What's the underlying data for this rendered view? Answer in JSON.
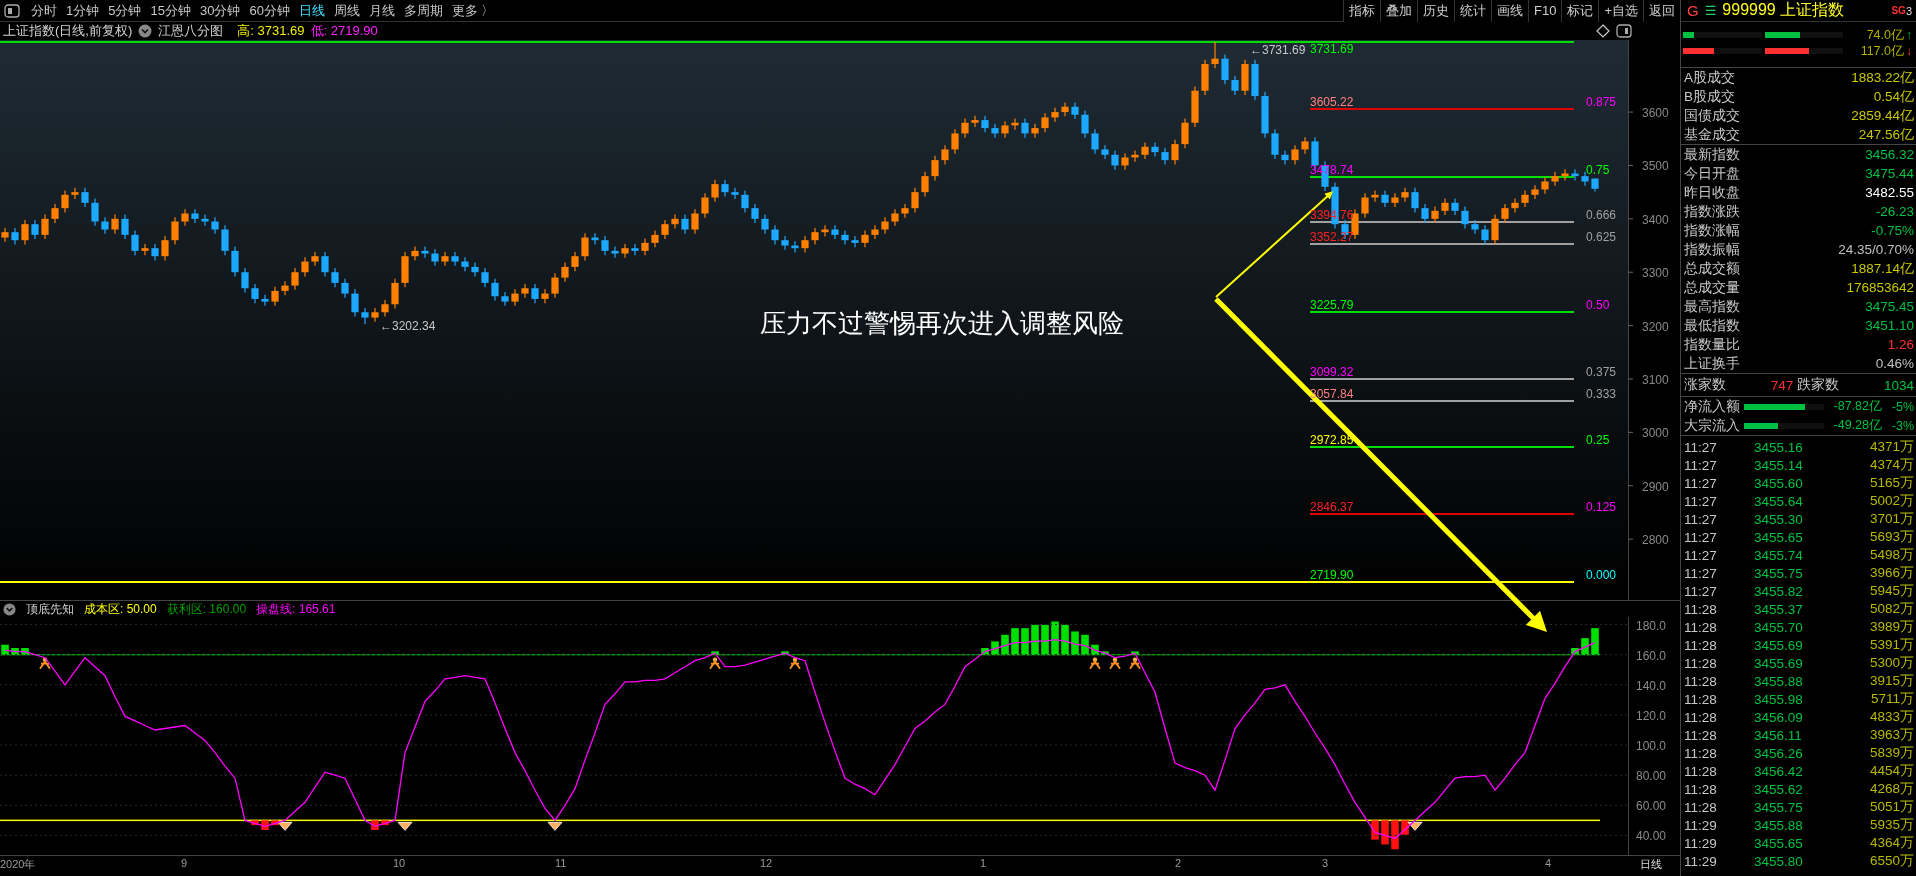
{
  "toolbar": {
    "periods": [
      {
        "label": "分时",
        "selected": false
      },
      {
        "label": "1分钟",
        "selected": false
      },
      {
        "label": "5分钟",
        "selected": false
      },
      {
        "label": "15分钟",
        "selected": false
      },
      {
        "label": "30分钟",
        "selected": false
      },
      {
        "label": "60分钟",
        "selected": false
      },
      {
        "label": "日线",
        "selected": true
      },
      {
        "label": "周线",
        "selected": false
      },
      {
        "label": "月线",
        "selected": false
      },
      {
        "label": "多周期",
        "selected": false
      },
      {
        "label": "更多 〉",
        "selected": false
      }
    ],
    "tools": [
      "指标",
      "叠加",
      "历史",
      "统计",
      "画线",
      "F10",
      "标记",
      "+自选",
      "返回"
    ]
  },
  "chart_header": {
    "title": "上证指数(日线,前复权)",
    "overlay": "江恩八分图",
    "high": "高: 3731.69",
    "low": "低: 2719.90"
  },
  "price_chart": {
    "chart_data": {
      "type": "candlestick",
      "ylim": [
        2686,
        3735
      ],
      "yticks": [
        {
          "value": 3600,
          "label": "3600"
        },
        {
          "value": 3500,
          "label": "3500"
        },
        {
          "value": 3400,
          "label": "3400"
        },
        {
          "value": 3300,
          "label": "3300"
        },
        {
          "value": 3200,
          "label": "3200"
        },
        {
          "value": 3100,
          "label": "3100"
        },
        {
          "value": 3000,
          "label": "3000"
        },
        {
          "value": 2900,
          "label": "2900"
        },
        {
          "value": 2800,
          "label": "2800"
        }
      ],
      "ohlc": [
        [
          3365,
          3383,
          3357,
          3375
        ],
        [
          3375,
          3383,
          3352,
          3360
        ],
        [
          3360,
          3398,
          3352,
          3390
        ],
        [
          3390,
          3398,
          3362,
          3370
        ],
        [
          3370,
          3408,
          3362,
          3400
        ],
        [
          3400,
          3428,
          3392,
          3420
        ],
        [
          3420,
          3453,
          3412,
          3445
        ],
        [
          3445,
          3458,
          3437,
          3450
        ],
        [
          3450,
          3458,
          3422,
          3430
        ],
        [
          3430,
          3438,
          3387,
          3395
        ],
        [
          3395,
          3403,
          3372,
          3380
        ],
        [
          3380,
          3408,
          3372,
          3400
        ],
        [
          3400,
          3408,
          3362,
          3370
        ],
        [
          3370,
          3378,
          3332,
          3340
        ],
        [
          3340,
          3353,
          3332,
          3345
        ],
        [
          3345,
          3353,
          3322,
          3330
        ],
        [
          3330,
          3368,
          3322,
          3360
        ],
        [
          3360,
          3403,
          3352,
          3395
        ],
        [
          3395,
          3418,
          3387,
          3410
        ],
        [
          3410,
          3418,
          3392,
          3400
        ],
        [
          3400,
          3408,
          3387,
          3395
        ],
        [
          3395,
          3403,
          3372,
          3380
        ],
        [
          3380,
          3388,
          3332,
          3340
        ],
        [
          3340,
          3348,
          3292,
          3300
        ],
        [
          3300,
          3308,
          3262,
          3270
        ],
        [
          3270,
          3278,
          3242,
          3250
        ],
        [
          3250,
          3258,
          3237,
          3245
        ],
        [
          3245,
          3273,
          3237,
          3265
        ],
        [
          3265,
          3283,
          3257,
          3275
        ],
        [
          3275,
          3308,
          3267,
          3300
        ],
        [
          3300,
          3328,
          3292,
          3320
        ],
        [
          3320,
          3338,
          3312,
          3330
        ],
        [
          3330,
          3338,
          3292,
          3300
        ],
        [
          3300,
          3308,
          3272,
          3280
        ],
        [
          3280,
          3288,
          3252,
          3260
        ],
        [
          3260,
          3268,
          3217,
          3225
        ],
        [
          3225,
          3233,
          3202.34,
          3215
        ],
        [
          3215,
          3233,
          3207,
          3225
        ],
        [
          3225,
          3248,
          3217,
          3240
        ],
        [
          3240,
          3288,
          3232,
          3280
        ],
        [
          3280,
          3338,
          3272,
          3330
        ],
        [
          3330,
          3348,
          3322,
          3340
        ],
        [
          3340,
          3348,
          3327,
          3335
        ],
        [
          3335,
          3343,
          3312,
          3320
        ],
        [
          3320,
          3338,
          3312,
          3330
        ],
        [
          3330,
          3338,
          3312,
          3320
        ],
        [
          3320,
          3328,
          3302,
          3310
        ],
        [
          3310,
          3318,
          3292,
          3300
        ],
        [
          3300,
          3308,
          3272,
          3280
        ],
        [
          3280,
          3288,
          3247,
          3255
        ],
        [
          3255,
          3263,
          3237,
          3245
        ],
        [
          3245,
          3268,
          3237,
          3260
        ],
        [
          3260,
          3278,
          3252,
          3270
        ],
        [
          3270,
          3278,
          3242,
          3250
        ],
        [
          3250,
          3268,
          3242,
          3260
        ],
        [
          3260,
          3298,
          3252,
          3290
        ],
        [
          3290,
          3318,
          3282,
          3310
        ],
        [
          3310,
          3338,
          3302,
          3330
        ],
        [
          3330,
          3373,
          3322,
          3365
        ],
        [
          3365,
          3373,
          3352,
          3360
        ],
        [
          3360,
          3368,
          3332,
          3340
        ],
        [
          3340,
          3348,
          3327,
          3335
        ],
        [
          3335,
          3353,
          3327,
          3345
        ],
        [
          3345,
          3353,
          3332,
          3340
        ],
        [
          3340,
          3363,
          3332,
          3355
        ],
        [
          3355,
          3378,
          3347,
          3370
        ],
        [
          3370,
          3398,
          3362,
          3390
        ],
        [
          3390,
          3408,
          3382,
          3400
        ],
        [
          3400,
          3408,
          3372,
          3380
        ],
        [
          3380,
          3418,
          3372,
          3410
        ],
        [
          3410,
          3448,
          3402,
          3440
        ],
        [
          3440,
          3473,
          3432,
          3465
        ],
        [
          3465,
          3473,
          3442,
          3450
        ],
        [
          3450,
          3458,
          3437,
          3445
        ],
        [
          3445,
          3453,
          3412,
          3420
        ],
        [
          3420,
          3428,
          3392,
          3400
        ],
        [
          3400,
          3408,
          3372,
          3380
        ],
        [
          3380,
          3388,
          3352,
          3360
        ],
        [
          3360,
          3368,
          3342,
          3350
        ],
        [
          3350,
          3358,
          3337,
          3345
        ],
        [
          3345,
          3368,
          3337,
          3360
        ],
        [
          3360,
          3383,
          3352,
          3375
        ],
        [
          3375,
          3388,
          3367,
          3380
        ],
        [
          3380,
          3388,
          3362,
          3370
        ],
        [
          3370,
          3378,
          3352,
          3360
        ],
        [
          3360,
          3368,
          3347,
          3355
        ],
        [
          3355,
          3378,
          3347,
          3370
        ],
        [
          3370,
          3388,
          3362,
          3380
        ],
        [
          3380,
          3403,
          3372,
          3395
        ],
        [
          3395,
          3418,
          3387,
          3410
        ],
        [
          3410,
          3428,
          3402,
          3420
        ],
        [
          3420,
          3458,
          3412,
          3450
        ],
        [
          3450,
          3488,
          3442,
          3480
        ],
        [
          3480,
          3518,
          3472,
          3510
        ],
        [
          3510,
          3538,
          3502,
          3530
        ],
        [
          3530,
          3568,
          3522,
          3560
        ],
        [
          3560,
          3588,
          3552,
          3580
        ],
        [
          3580,
          3593,
          3572,
          3585
        ],
        [
          3585,
          3593,
          3562,
          3570
        ],
        [
          3570,
          3578,
          3552,
          3560
        ],
        [
          3560,
          3583,
          3552,
          3575
        ],
        [
          3575,
          3588,
          3567,
          3580
        ],
        [
          3580,
          3588,
          3552,
          3560
        ],
        [
          3560,
          3578,
          3552,
          3570
        ],
        [
          3570,
          3598,
          3562,
          3590
        ],
        [
          3590,
          3608,
          3582,
          3600
        ],
        [
          3600,
          3618,
          3592,
          3610
        ],
        [
          3610,
          3618,
          3587,
          3595
        ],
        [
          3595,
          3603,
          3552,
          3560
        ],
        [
          3560,
          3568,
          3522,
          3530
        ],
        [
          3530,
          3538,
          3512,
          3520
        ],
        [
          3520,
          3528,
          3492,
          3500
        ],
        [
          3500,
          3523,
          3492,
          3515
        ],
        [
          3515,
          3528,
          3507,
          3520
        ],
        [
          3520,
          3543,
          3512,
          3535
        ],
        [
          3535,
          3543,
          3517,
          3525
        ],
        [
          3525,
          3533,
          3502,
          3510
        ],
        [
          3510,
          3548,
          3502,
          3540
        ],
        [
          3540,
          3588,
          3532,
          3580
        ],
        [
          3580,
          3648,
          3572,
          3640
        ],
        [
          3640,
          3698,
          3632,
          3690
        ],
        [
          3690,
          3731.69,
          3682,
          3700
        ],
        [
          3700,
          3708,
          3652,
          3660
        ],
        [
          3660,
          3668,
          3632,
          3640
        ],
        [
          3640,
          3698,
          3632,
          3690
        ],
        [
          3690,
          3698,
          3622,
          3630
        ],
        [
          3630,
          3638,
          3552,
          3560
        ],
        [
          3560,
          3568,
          3512,
          3520
        ],
        [
          3520,
          3528,
          3502,
          3510
        ],
        [
          3510,
          3538,
          3502,
          3530
        ],
        [
          3530,
          3553,
          3522,
          3545
        ],
        [
          3545,
          3553,
          3492,
          3500
        ],
        [
          3500,
          3508,
          3452,
          3460
        ],
        [
          3460,
          3468,
          3382,
          3390
        ],
        [
          3390,
          3398,
          3362,
          3370
        ],
        [
          3370,
          3418,
          3362,
          3410
        ],
        [
          3410,
          3448,
          3402,
          3440
        ],
        [
          3440,
          3453,
          3432,
          3445
        ],
        [
          3445,
          3453,
          3422,
          3430
        ],
        [
          3430,
          3448,
          3422,
          3440
        ],
        [
          3440,
          3458,
          3432,
          3450
        ],
        [
          3450,
          3458,
          3412,
          3420
        ],
        [
          3420,
          3428,
          3392,
          3400
        ],
        [
          3400,
          3423,
          3392,
          3415
        ],
        [
          3415,
          3438,
          3407,
          3430
        ],
        [
          3430,
          3438,
          3407,
          3415
        ],
        [
          3415,
          3423,
          3382,
          3390
        ],
        [
          3390,
          3398,
          3372,
          3380
        ],
        [
          3380,
          3388,
          3352,
          3360
        ],
        [
          3360,
          3408,
          3352,
          3400
        ],
        [
          3400,
          3428,
          3392,
          3420
        ],
        [
          3420,
          3438,
          3412,
          3430
        ],
        [
          3430,
          3453,
          3422,
          3445
        ],
        [
          3445,
          3463,
          3437,
          3455
        ],
        [
          3455,
          3478,
          3447,
          3470
        ],
        [
          3470,
          3488,
          3462,
          3480
        ],
        [
          3480,
          3493,
          3472,
          3485
        ],
        [
          3485,
          3493,
          3472,
          3480
        ],
        [
          3480,
          3488,
          3462,
          3470
        ],
        [
          3475.44,
          3475.45,
          3451.1,
          3456.32
        ]
      ]
    },
    "fib_levels": [
      {
        "value": {
          "text": "3731.69",
          "color": "#00ff00"
        },
        "color": "#00e000",
        "extended": true
      },
      {
        "value": {
          "text": "3605.22",
          "color": "#ff8080"
        },
        "ratio": {
          "text": "0.875",
          "color": "#ff00ff"
        },
        "color": "#e00000",
        "extended": false
      },
      {
        "value": {
          "text": "3478.74",
          "color": "#ff00ff"
        },
        "ratio": {
          "text": "0.75",
          "color": "#00ff00"
        },
        "color": "#00e000",
        "extended": false
      },
      {
        "value": {
          "text": "3394.76",
          "color": "#ff2020"
        },
        "ratio": {
          "text": "0.666",
          "color": "#a0a0a0"
        },
        "color": "#a0a0a0",
        "extended": false
      },
      {
        "value": {
          "text": "3352.27",
          "color": "#ff2020"
        },
        "ratio": {
          "text": "0.625",
          "color": "#a0a0a0"
        },
        "color": "#a0a0a0",
        "extended": false
      },
      {
        "value": {
          "text": "3225.79",
          "color": "#00ff00"
        },
        "ratio": {
          "text": "0.50",
          "color": "#ff00ff"
        },
        "color": "#00e000",
        "extended": false
      },
      {
        "value": {
          "text": "3099.32",
          "color": "#ff00ff"
        },
        "ratio": {
          "text": "0.375",
          "color": "#a0a0a0"
        },
        "color": "#a0a0a0",
        "extended": false
      },
      {
        "value": {
          "text": "3057.84",
          "color": "#ff8080"
        },
        "ratio": {
          "text": "0.333",
          "color": "#a0a0a0"
        },
        "color": "#a0a0a0",
        "extended": false
      },
      {
        "value": {
          "text": "2972.85",
          "color": "#ffff00"
        },
        "ratio": {
          "text": "0.25",
          "color": "#00ff00"
        },
        "color": "#00e000",
        "extended": false
      },
      {
        "value": {
          "text": "2846.37",
          "color": "#ff2020"
        },
        "ratio": {
          "text": "0.125",
          "color": "#ff00ff"
        },
        "color": "#e00000",
        "extended": false
      },
      {
        "value": {
          "text": "2719.90",
          "color": "#00ff00"
        },
        "ratio": {
          "text": "0.000",
          "color": "#00ffff"
        },
        "color": "#ffff00",
        "extended": true
      }
    ],
    "high_marker": "←3731.69",
    "low_marker": "←3202.34",
    "annotation": "压力不过警惕再次进入调整风险"
  },
  "indicator": {
    "name": "顶底先知",
    "legend": [
      {
        "text": "成本区: 50.00",
        "color": "#ffff00"
      },
      {
        "text": "获利区: 160.00",
        "color": "#00a000"
      },
      {
        "text": "操盘线: 165.61",
        "color": "#ff00ff"
      }
    ],
    "chart_data": {
      "type": "line",
      "grid": true,
      "ylim": [
        27,
        185
      ],
      "yticks": [
        {
          "value": 180,
          "label": "180.0"
        },
        {
          "value": 160,
          "label": "160.0"
        },
        {
          "value": 140,
          "label": "140.0"
        },
        {
          "value": 120,
          "label": "120.0"
        },
        {
          "value": 100,
          "label": "100.0"
        },
        {
          "value": 80,
          "label": "80.00"
        },
        {
          "value": 60,
          "label": "60.00"
        },
        {
          "value": 40,
          "label": "40.00"
        }
      ],
      "series": [
        {
          "color": "#ff00ff",
          "values": [
            163,
            162,
            162,
            160,
            158,
            149,
            140,
            149,
            158,
            152,
            146,
            132,
            119,
            116,
            113,
            110,
            111,
            112,
            113,
            108,
            103,
            95,
            86,
            78,
            50,
            48,
            46,
            48,
            50,
            56,
            62,
            72,
            82,
            80,
            78,
            64,
            50,
            46,
            48,
            50,
            95,
            112,
            129,
            136,
            144,
            145,
            146,
            145,
            144,
            128,
            111,
            95,
            83,
            70,
            58,
            50,
            60,
            71,
            90,
            108,
            127,
            134,
            142,
            142,
            143,
            143,
            144,
            148,
            152,
            156,
            158,
            161,
            152,
            152,
            153,
            155,
            157,
            159,
            161,
            158,
            156,
            135,
            115,
            96,
            78,
            74,
            71,
            67,
            77,
            87,
            99,
            111,
            116,
            122,
            127,
            139,
            152,
            157,
            162,
            164,
            166,
            168,
            168,
            169,
            169,
            170,
            169,
            167,
            166,
            163,
            161,
            158,
            159,
            161,
            148,
            135,
            111,
            88,
            85,
            83,
            80,
            70,
            90,
            111,
            120,
            128,
            137,
            138,
            140,
            129,
            119,
            108,
            98,
            87,
            74,
            62,
            52,
            42,
            40,
            38,
            44,
            50,
            56,
            62,
            70,
            78,
            79,
            79,
            80,
            70,
            78,
            87,
            95,
            113,
            131,
            141,
            152,
            162,
            165,
            168
          ]
        }
      ]
    }
  },
  "time_axis": {
    "labels": [
      "2020年",
      "9",
      "10",
      "11",
      "12",
      "1",
      "2",
      "3",
      "4"
    ],
    "period": "日线"
  },
  "quote": {
    "market": "G",
    "menu": "☰",
    "title": "999999 上证指数",
    "tag": "SG",
    "tag_count": "3",
    "flow_bars": [
      {
        "bars": [
          {
            "level": 0.14
          },
          {
            "level": 0.45
          }
        ],
        "value": "74.0亿",
        "arrow": "↑",
        "rising": true
      },
      {
        "bars": [
          {
            "level": 0.39
          },
          {
            "level": 0.57
          }
        ],
        "value": "117.0亿",
        "arrow": "↓",
        "rising": false
      }
    ],
    "turnover": [
      {
        "label": "A股成交",
        "value": "1883.22亿",
        "color": "#c8c800"
      },
      {
        "label": "B股成交",
        "value": "0.54亿",
        "color": "#c8c800"
      },
      {
        "label": "国债成交",
        "value": "2859.44亿",
        "color": "#c8c800"
      },
      {
        "label": "基金成交",
        "value": "247.56亿",
        "color": "#c8c800"
      }
    ],
    "stats": [
      {
        "label": "最新指数",
        "value": "3456.32",
        "color": "#00c040"
      },
      {
        "label": "今日开盘",
        "value": "3475.44",
        "color": "#00c040"
      },
      {
        "label": "昨日收盘",
        "value": "3482.55",
        "color": "#ffffff"
      },
      {
        "label": "指数涨跌",
        "value": "-26.23",
        "color": "#00c040"
      },
      {
        "label": "指数涨幅",
        "value": "-0.75%",
        "color": "#00c040"
      },
      {
        "label": "指数振幅",
        "value": "24.35/0.70%",
        "color": "#c0c0c0"
      },
      {
        "label": "总成交额",
        "value": "1887.14亿",
        "color": "#c8c800"
      },
      {
        "label": "总成交量",
        "value": "176853642",
        "color": "#c8c800"
      },
      {
        "label": "最高指数",
        "value": "3475.45",
        "color": "#00c040"
      },
      {
        "label": "最低指数",
        "value": "3451.10",
        "color": "#00c040"
      },
      {
        "label": "指数量比",
        "value": "1.26",
        "color": "#ff3030"
      },
      {
        "label": "上证换手",
        "value": "0.46%",
        "color": "#c0c0c0"
      }
    ],
    "breadth": {
      "up_label": "涨家数",
      "up": "747",
      "down_label": "跌家数",
      "down": "1034"
    },
    "net_flow": [
      {
        "label": "净流入额",
        "level": 0.76,
        "value": "-87.82亿",
        "pct": "-5%"
      },
      {
        "label": "大宗流入",
        "level": 0.42,
        "value": "-49.28亿",
        "pct": "-3%"
      }
    ],
    "ticks": [
      {
        "time": "11:27",
        "price": "3455.16",
        "volume": "4371万"
      },
      {
        "time": "11:27",
        "price": "3455.14",
        "volume": "4374万"
      },
      {
        "time": "11:27",
        "price": "3455.60",
        "volume": "5165万"
      },
      {
        "time": "11:27",
        "price": "3455.64",
        "volume": "5002万"
      },
      {
        "time": "11:27",
        "price": "3455.30",
        "volume": "3701万"
      },
      {
        "time": "11:27",
        "price": "3455.65",
        "volume": "5693万"
      },
      {
        "time": "11:27",
        "price": "3455.74",
        "volume": "5498万"
      },
      {
        "time": "11:27",
        "price": "3455.75",
        "volume": "3966万"
      },
      {
        "time": "11:27",
        "price": "3455.82",
        "volume": "5945万"
      },
      {
        "time": "11:28",
        "price": "3455.37",
        "volume": "5082万"
      },
      {
        "time": "11:28",
        "price": "3455.70",
        "volume": "3989万"
      },
      {
        "time": "11:28",
        "price": "3455.69",
        "volume": "5391万"
      },
      {
        "time": "11:28",
        "price": "3455.69",
        "volume": "5300万"
      },
      {
        "time": "11:28",
        "price": "3455.88",
        "volume": "3915万"
      },
      {
        "time": "11:28",
        "price": "3455.98",
        "volume": "5711万"
      },
      {
        "time": "11:28",
        "price": "3456.09",
        "volume": "4833万"
      },
      {
        "time": "11:28",
        "price": "3456.11",
        "volume": "3963万"
      },
      {
        "time": "11:28",
        "price": "3456.26",
        "volume": "5839万"
      },
      {
        "time": "11:28",
        "price": "3456.42",
        "volume": "4454万"
      },
      {
        "time": "11:28",
        "price": "3455.62",
        "volume": "4268万"
      },
      {
        "time": "11:28",
        "price": "3455.75",
        "volume": "5051万"
      },
      {
        "time": "11:29",
        "price": "3455.88",
        "volume": "5935万"
      },
      {
        "time": "11:29",
        "price": "3455.65",
        "volume": "4364万"
      },
      {
        "time": "11:29",
        "price": "3455.80",
        "volume": "6550万"
      }
    ]
  }
}
